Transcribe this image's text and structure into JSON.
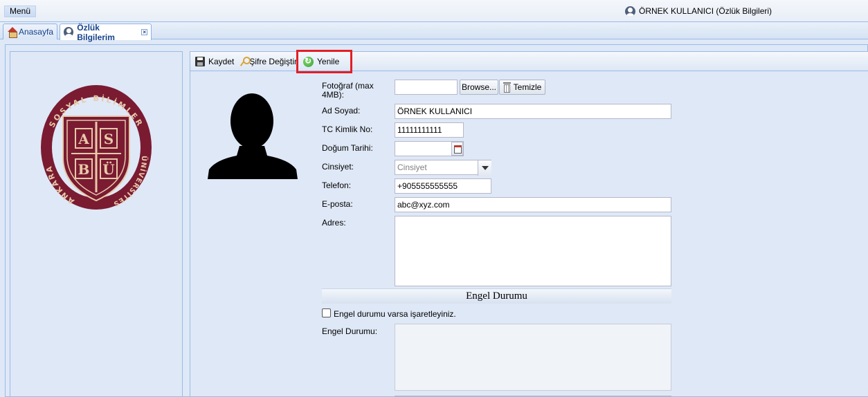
{
  "header": {
    "menu_label": "Menü",
    "user_label": "ÖRNEK KULLANICI (Özlük Bilgileri)"
  },
  "tabs": {
    "home_label": "Anasayfa",
    "active_label": "Özlük Bilgilerim",
    "close_glyph": "×"
  },
  "toolbar": {
    "save_label": "Kaydet",
    "password_label": "Şifre Değiştir",
    "refresh_label": "Yenile"
  },
  "logo": {
    "arc_top": "SOSYAL BİLİMLER",
    "arc_left": "ANKARA",
    "arc_right": "ÜNİVERSİTESİ",
    "monogram_top": [
      "A",
      "S"
    ],
    "monogram_bottom": [
      "B",
      "Ü"
    ],
    "colors": {
      "primary": "#7a1b32",
      "accent": "#e8c9a8"
    }
  },
  "form": {
    "photo_label": "Fotoğraf (max 4MB):",
    "photo_value": "",
    "browse_label": "Browse...",
    "clear_label": "Temizle",
    "name_label": "Ad Soyad:",
    "name_value": "ÖRNEK KULLANICI",
    "tc_label": "TC Kimlik No:",
    "tc_value": "11111111111",
    "birth_label": "Doğum Tarihi:",
    "birth_value": "",
    "gender_label": "Cinsiyet:",
    "gender_placeholder": "Cinsiyet",
    "phone_label": "Telefon:",
    "phone_value": "+905555555555",
    "email_label": "E-posta:",
    "email_value": "abc@xyz.com",
    "address_label": "Adres:",
    "address_value": ""
  },
  "disability": {
    "section_title": "Engel Durumu",
    "checkbox_label": "Engel durumu varsa işaretleyiniz.",
    "field_label": "Engel Durumu:",
    "checked": false
  }
}
